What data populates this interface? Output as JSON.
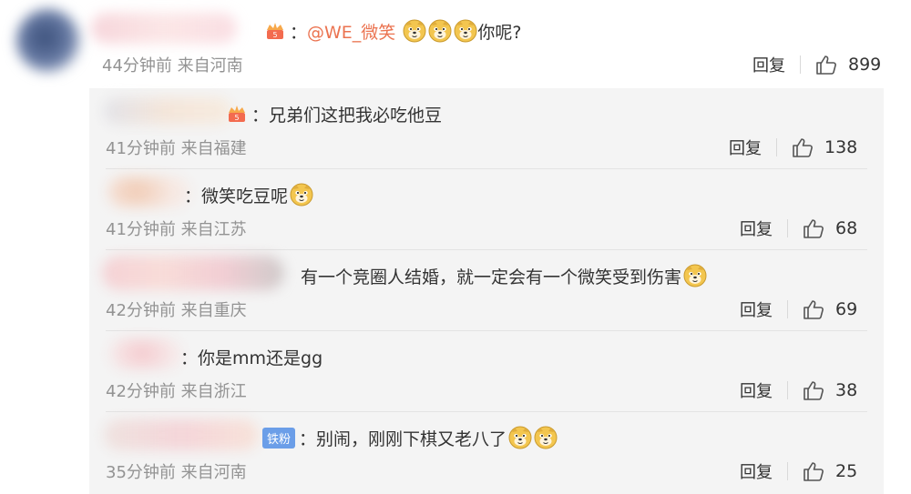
{
  "main_comment": {
    "prefix": "：",
    "mention": "@WE_微笑",
    "text": "你呢?",
    "meta": "44分钟前 来自河南",
    "reply_label": "回复",
    "likes": "899"
  },
  "replies": [
    {
      "text": "：兄弟们这把我必吃他豆",
      "meta": "41分钟前 来自福建",
      "reply_label": "回复",
      "likes": "138"
    },
    {
      "text": "：微笑吃豆呢",
      "meta": "41分钟前 来自江苏",
      "reply_label": "回复",
      "likes": "68"
    },
    {
      "text": "有一个竞圈人结婚，就一定会有一个微笑受到伤害",
      "meta": "42分钟前 来自重庆",
      "reply_label": "回复",
      "likes": "69"
    },
    {
      "text": "：你是mm还是gg",
      "meta": "42分钟前 来自浙江",
      "reply_label": "回复",
      "likes": "38"
    },
    {
      "badge": "铁粉",
      "text": "：别闹，刚刚下棋又老八了",
      "meta": "35分钟前 来自河南",
      "reply_label": "回复",
      "likes": "25"
    }
  ],
  "colors": {
    "mention": "#eb7350",
    "panel": "#f4f4f4",
    "meta": "#939393"
  },
  "icons": {
    "like": "thumbs-up-icon",
    "emoji": "doge-emoji-icon",
    "vip": "vip-badge-icon"
  }
}
